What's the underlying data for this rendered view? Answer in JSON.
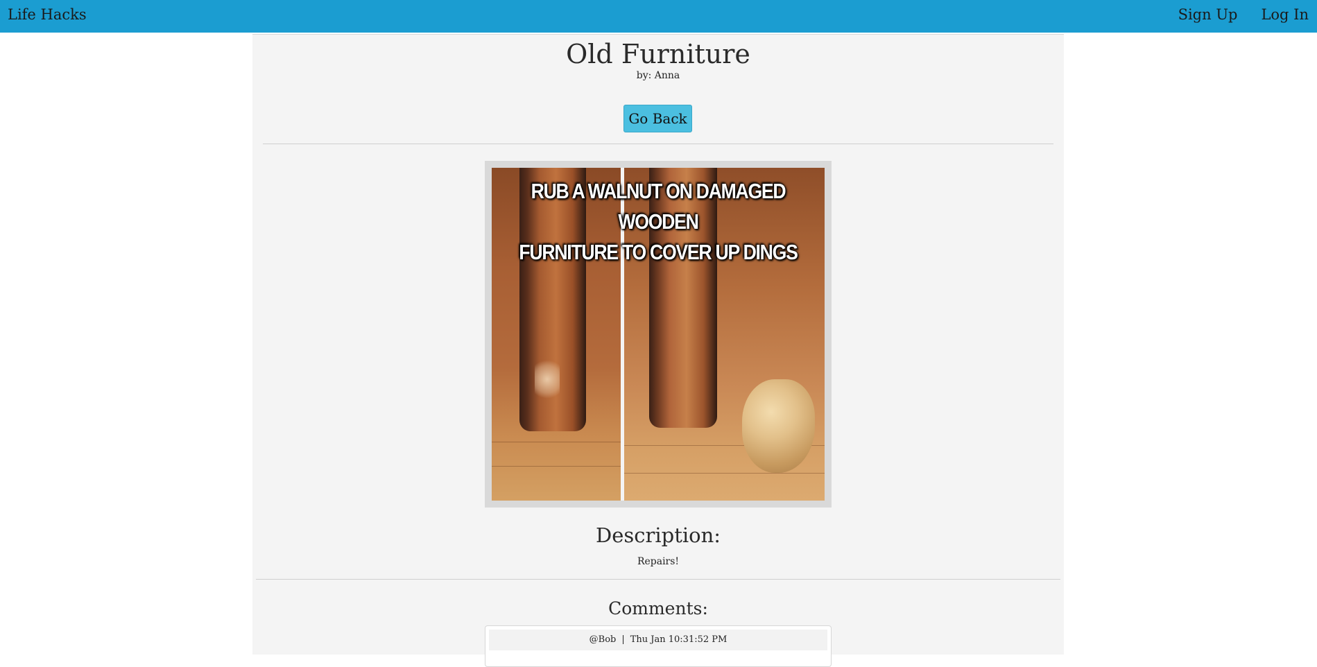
{
  "navbar": {
    "brand": "Life Hacks",
    "links": [
      "Sign Up",
      "Log In"
    ],
    "color": "#1b9dd1"
  },
  "post": {
    "title": "Old Furniture",
    "byline": "by: Anna",
    "back_button": "Go Back",
    "image_caption_line1": "RUB A WALNUT ON DAMAGED WOODEN",
    "image_caption_line2": "FURNITURE TO COVER UP DINGS",
    "description_heading": "Description:",
    "description": "Repairs!"
  },
  "comments": {
    "heading": "Comments:",
    "items": [
      {
        "author": "@Bob",
        "separator": "|",
        "timestamp": "Thu Jan 10:31:52 PM"
      }
    ]
  }
}
